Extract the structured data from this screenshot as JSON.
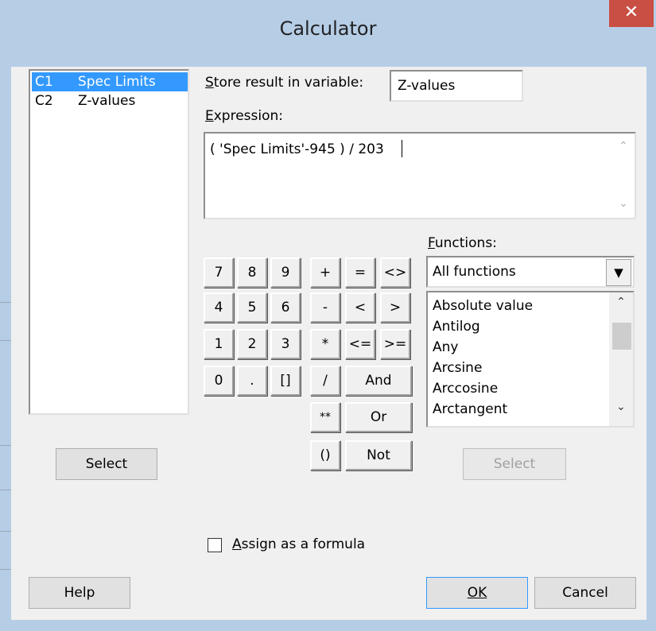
{
  "window": {
    "title": "Calculator",
    "close_glyph": "✕"
  },
  "variables": [
    {
      "col": "C1",
      "name": "Spec Limits",
      "selected": true
    },
    {
      "col": "C2",
      "name": "Z-values",
      "selected": false
    }
  ],
  "left_select_label": "Select",
  "store": {
    "label": "Store result in variable:",
    "value": "Z-values"
  },
  "expression": {
    "label": "Expression:",
    "value": "( 'Spec Limits'-945 ) / 203"
  },
  "keypad": {
    "digits": [
      "7",
      "8",
      "9",
      "4",
      "5",
      "6",
      "1",
      "2",
      "3",
      "0",
      ".",
      "[]"
    ],
    "operators": [
      "+",
      "-",
      "*",
      "/",
      "**",
      "()"
    ],
    "comparisons": [
      "=",
      "<>",
      "<",
      ">",
      "<=",
      ">="
    ],
    "logicals": [
      "And",
      "Or",
      "Not"
    ]
  },
  "functions": {
    "label": "Functions:",
    "selected_category": "All functions",
    "items": [
      "Absolute value",
      "Antilog",
      "Any",
      "Arcsine",
      "Arccosine",
      "Arctangent"
    ],
    "select_label": "Select"
  },
  "assign_formula": {
    "label": "Assign as a formula",
    "checked": false
  },
  "footer": {
    "help": "Help",
    "ok": "OK",
    "cancel": "Cancel"
  }
}
